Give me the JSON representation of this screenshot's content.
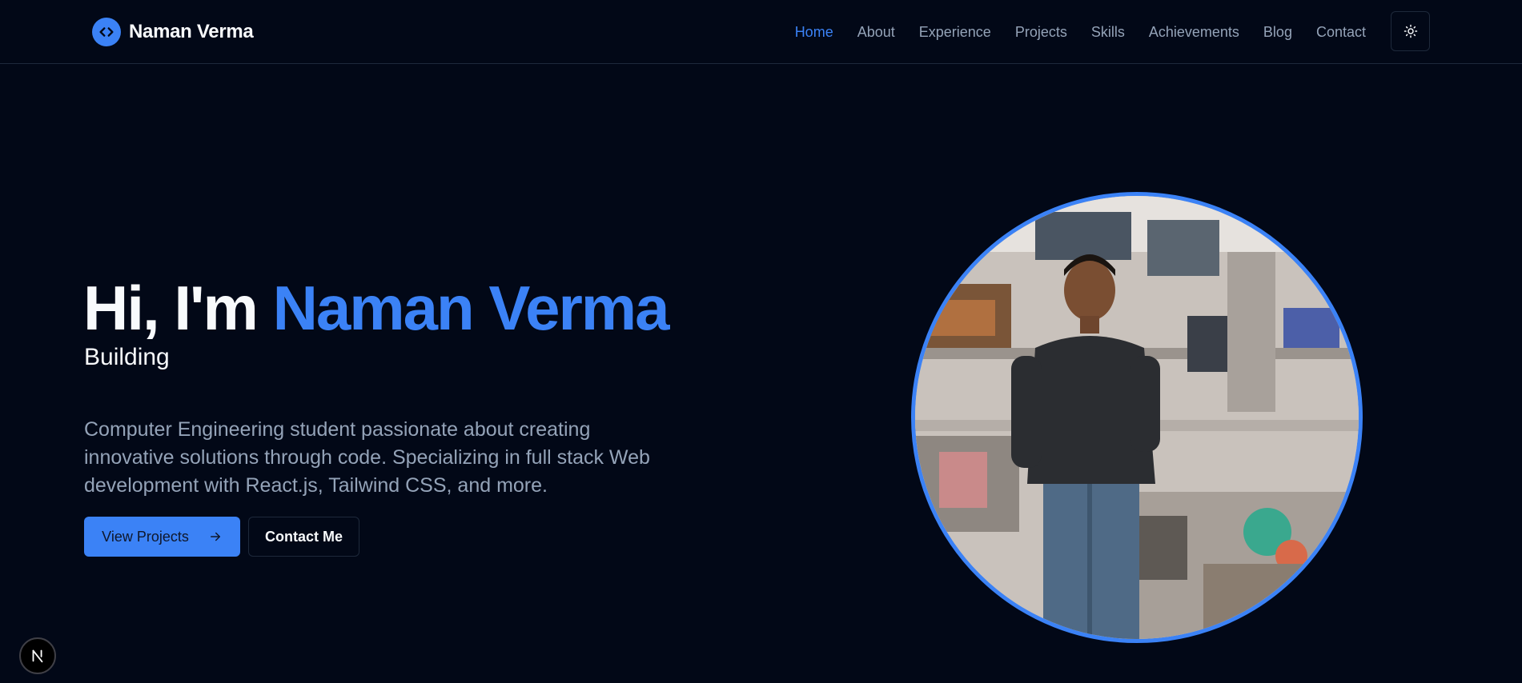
{
  "brand": {
    "name": "Naman Verma",
    "icon": "code-icon"
  },
  "nav": {
    "items": [
      {
        "label": "Home",
        "active": true
      },
      {
        "label": "About",
        "active": false
      },
      {
        "label": "Experience",
        "active": false
      },
      {
        "label": "Projects",
        "active": false
      },
      {
        "label": "Skills",
        "active": false
      },
      {
        "label": "Achievements",
        "active": false
      },
      {
        "label": "Blog",
        "active": false
      },
      {
        "label": "Contact",
        "active": false
      }
    ],
    "theme_toggle_icon": "sun-icon"
  },
  "hero": {
    "greeting": "Hi, I'm ",
    "name": "Naman Verma",
    "subtitle": "Building",
    "description": "Computer Engineering student passionate about creating innovative solutions through code. Specializing in full stack Web development with React.js, Tailwind CSS, and more.",
    "primary_button": "View Projects",
    "primary_button_icon": "arrow-right-icon",
    "secondary_button": "Contact Me"
  },
  "portrait": {
    "icon": "profile-photo"
  },
  "dev_badge": {
    "icon": "next-logo-icon"
  },
  "colors": {
    "background": "#020817",
    "accent": "#3b82f6",
    "muted": "#94a3b8",
    "border": "#1e293b",
    "text": "#f8fafc"
  }
}
